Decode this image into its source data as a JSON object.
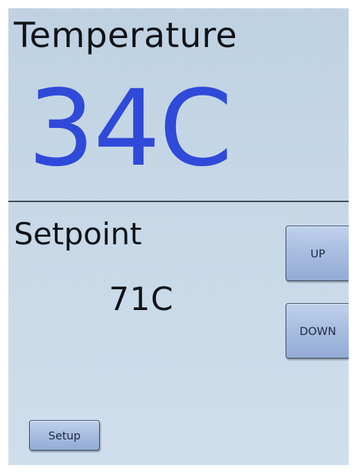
{
  "temperature": {
    "title": "Temperature",
    "value": "34C",
    "value_color": "#2f4ad8"
  },
  "setpoint": {
    "title": "Setpoint",
    "value": "71C"
  },
  "controls": {
    "up_label": "UP",
    "down_label": "DOWN",
    "setup_label": "Setup"
  }
}
